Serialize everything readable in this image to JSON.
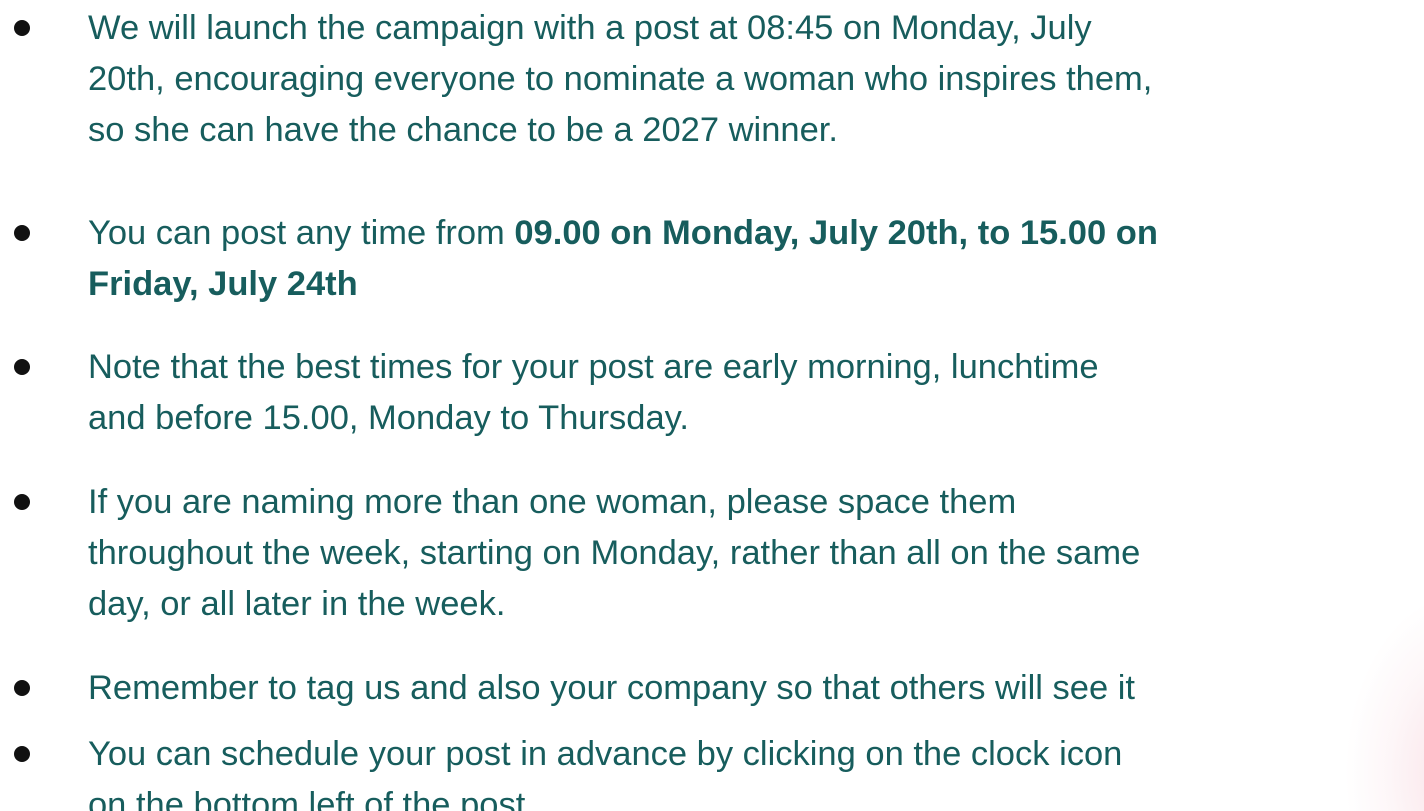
{
  "bullets": [
    {
      "lines": [
        "We will launch the campaign with a post at 08:45 on Monday, July",
        "20th, encouraging everyone to nominate a woman who inspires them,",
        "so she can have the chance to be a 2027 winner."
      ]
    },
    {
      "prefix": "You can post any time from ",
      "bold_part1": "09.00 on Monday, July 20th, to 15.00 on",
      "bold_part2": "Friday, July 24th"
    },
    {
      "lines": [
        "Note that the best times for your post are early morning, lunchtime",
        "and before 15.00, Monday to Thursday."
      ]
    },
    {
      "lines": [
        "If you are naming more than one woman, please space them",
        "throughout the week, starting on Monday, rather than all on the same",
        "day, or all later in the week."
      ]
    },
    {
      "lines": [
        "Remember to tag us and also your company so that others will see it"
      ]
    },
    {
      "lines": [
        "You can schedule your post in advance by clicking on the clock icon",
        "on the bottom left of the post"
      ]
    }
  ],
  "colors": {
    "text": "#175d5d",
    "bullet": "#111111",
    "background": "#ffffff"
  }
}
